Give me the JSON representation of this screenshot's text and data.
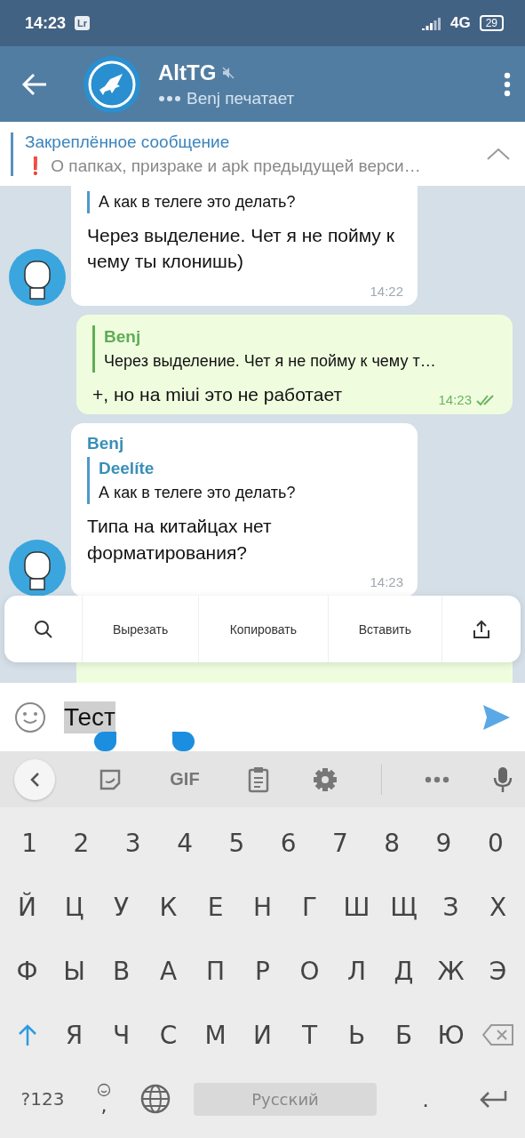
{
  "status_bar": {
    "time": "14:23",
    "badge": "Lr",
    "network": "4G",
    "battery": "29"
  },
  "header": {
    "title": "AltTG",
    "muted": true,
    "subtitle": "Benj печатает",
    "typing": true
  },
  "pinned": {
    "title": "Закреплённое сообщение",
    "text": "❗ О папках, призраке и apk предыдущей верси…"
  },
  "messages": [
    {
      "kind": "incoming",
      "avatar": true,
      "quote": {
        "text": "А как в телеге это делать?"
      },
      "text": "Через выделение. Чет я не пойму к чему ты клонишь)",
      "time": "14:22"
    },
    {
      "kind": "outgoing",
      "quote": {
        "author": "Benj",
        "text": "Через выделение. Чет я не пойму к чему т…"
      },
      "text": "+, но на miui это не работает",
      "time": "14:23",
      "read": true
    },
    {
      "kind": "incoming",
      "avatar": true,
      "author": "Benj",
      "quote": {
        "author": "Deelíte",
        "text": "А как в телеге это делать?"
      },
      "text": "Типа на китайцах нет форматирования?",
      "time": "14:23"
    },
    {
      "kind": "outgoing"
    }
  ],
  "context_menu": {
    "items": [
      "Вырезать",
      "Копировать",
      "Вставить"
    ]
  },
  "composer": {
    "value": "Тест",
    "selected": true
  },
  "keyboard_toolbar": {
    "gif": "GIF"
  },
  "keyboard": {
    "number_row": [
      "1",
      "2",
      "3",
      "4",
      "5",
      "6",
      "7",
      "8",
      "9",
      "0"
    ],
    "rows": [
      [
        "Й",
        "Ц",
        "У",
        "К",
        "Е",
        "Н",
        "Г",
        "Ш",
        "Щ",
        "З",
        "Х"
      ],
      [
        "Ф",
        "Ы",
        "В",
        "А",
        "П",
        "Р",
        "О",
        "Л",
        "Д",
        "Ж",
        "Э"
      ]
    ],
    "shift_row": [
      "Я",
      "Ч",
      "С",
      "М",
      "И",
      "Т",
      "Ь",
      "Б",
      "Ю"
    ],
    "shift_on": true,
    "symbols": "?123",
    "comma": ",",
    "space": "Русский",
    "period": "."
  }
}
